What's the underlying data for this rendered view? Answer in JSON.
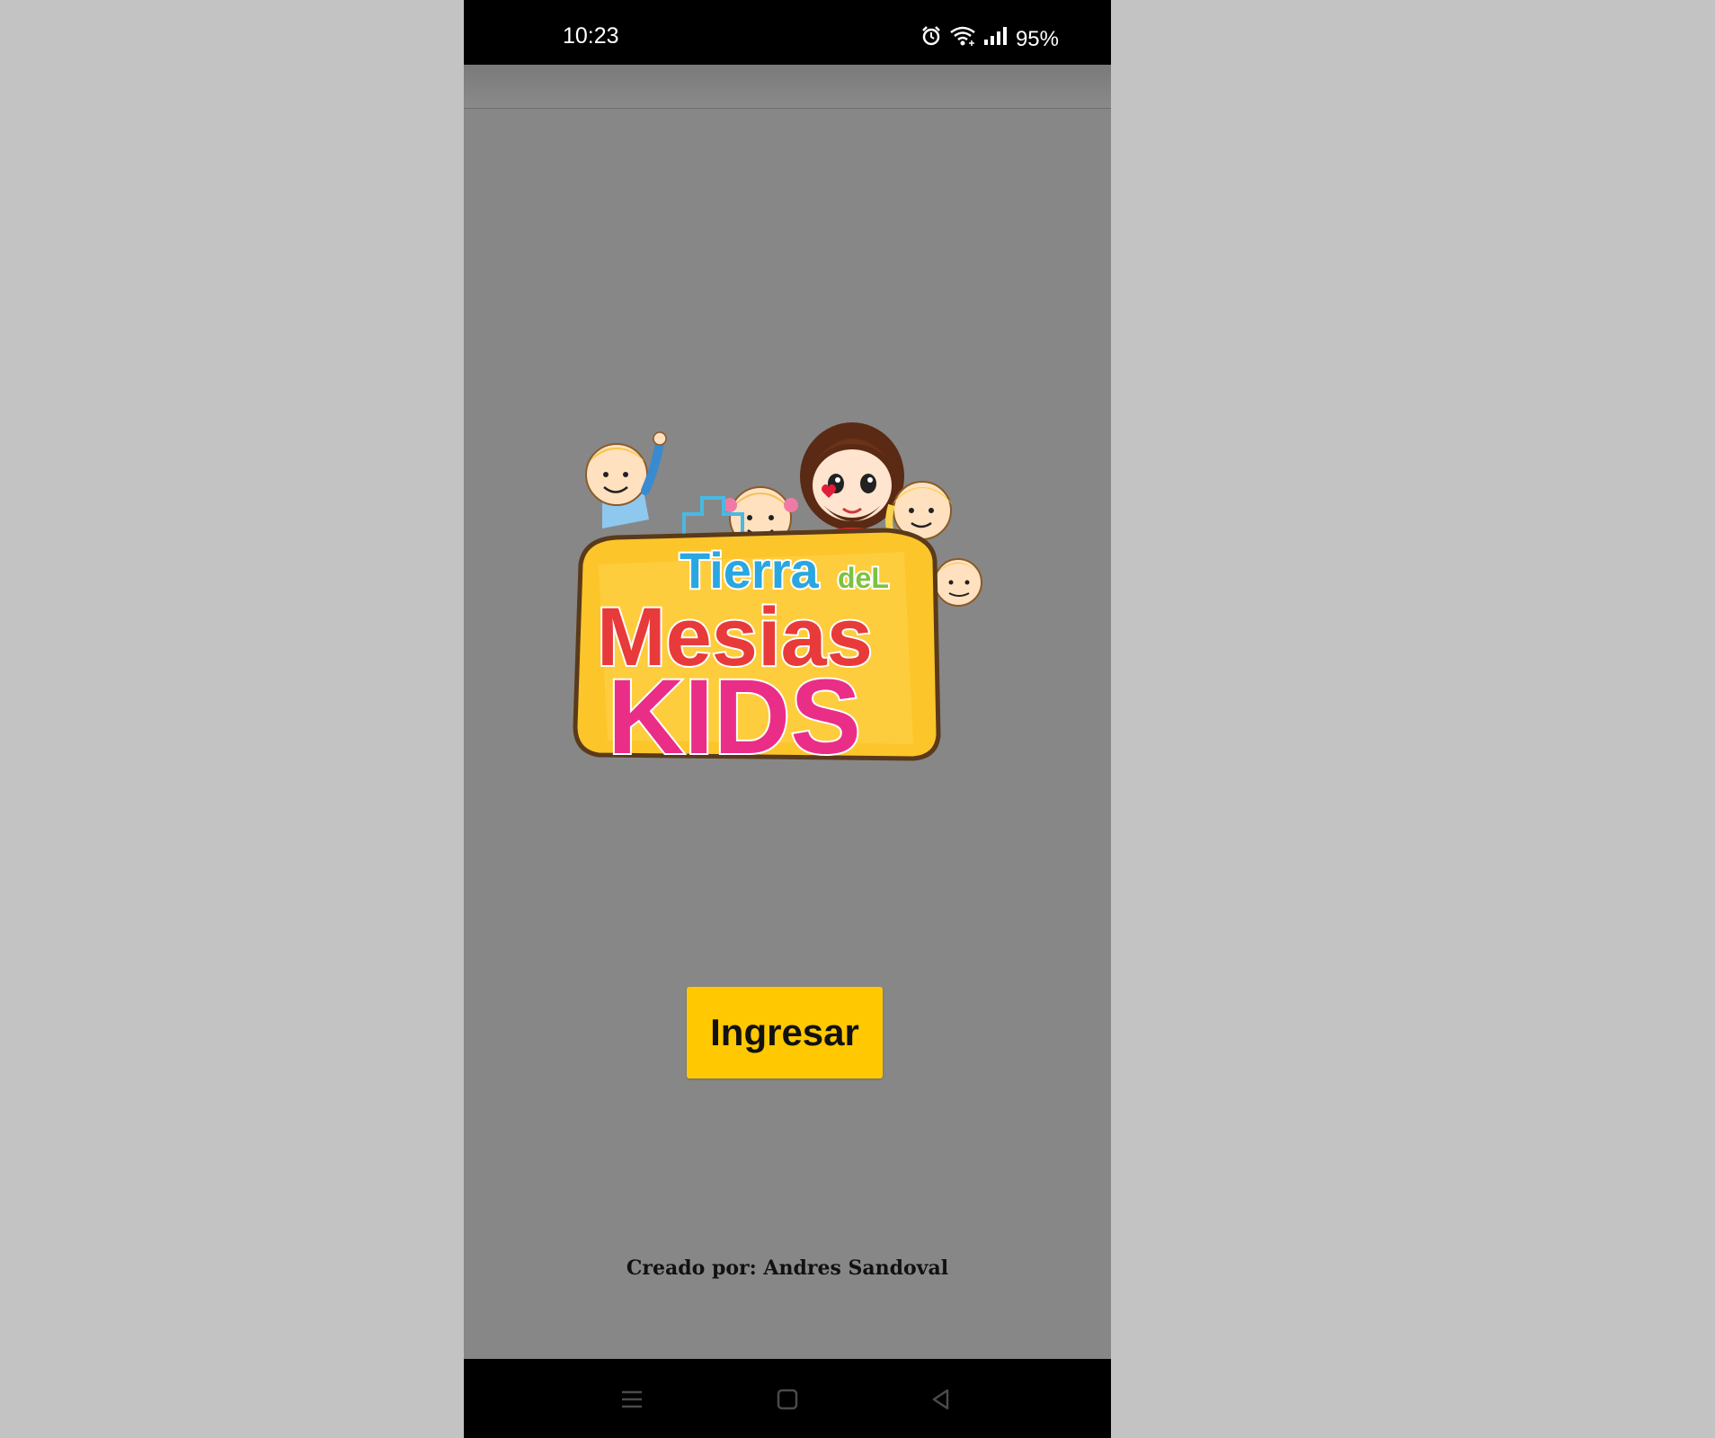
{
  "status_bar": {
    "time": "10:23",
    "battery": "95%",
    "icons": [
      "alarm-icon",
      "wifi-icon",
      "signal-icon"
    ]
  },
  "logo": {
    "line1": "Tierra",
    "line1_small": "deL",
    "line2": "Mesias",
    "line3": "KIDS",
    "colors": {
      "panel": "#fcc52a",
      "panel_border": "#5a3a1a",
      "red": "#e83a3a",
      "orange": "#f58a1f",
      "yellow": "#ffd21f",
      "green": "#7cc242",
      "blue": "#2aa6e0",
      "pink": "#ea2e87",
      "purple": "#8e3bb8"
    }
  },
  "main": {
    "enter_button_label": "Ingresar",
    "credit_text": "Creado por: Andres Sandoval"
  },
  "nav_bar": {
    "items": [
      "menu-icon",
      "home-icon",
      "back-icon"
    ]
  },
  "colors": {
    "page_background": "#c3c3c3",
    "app_background": "#878787",
    "button_background": "#ffc800"
  }
}
